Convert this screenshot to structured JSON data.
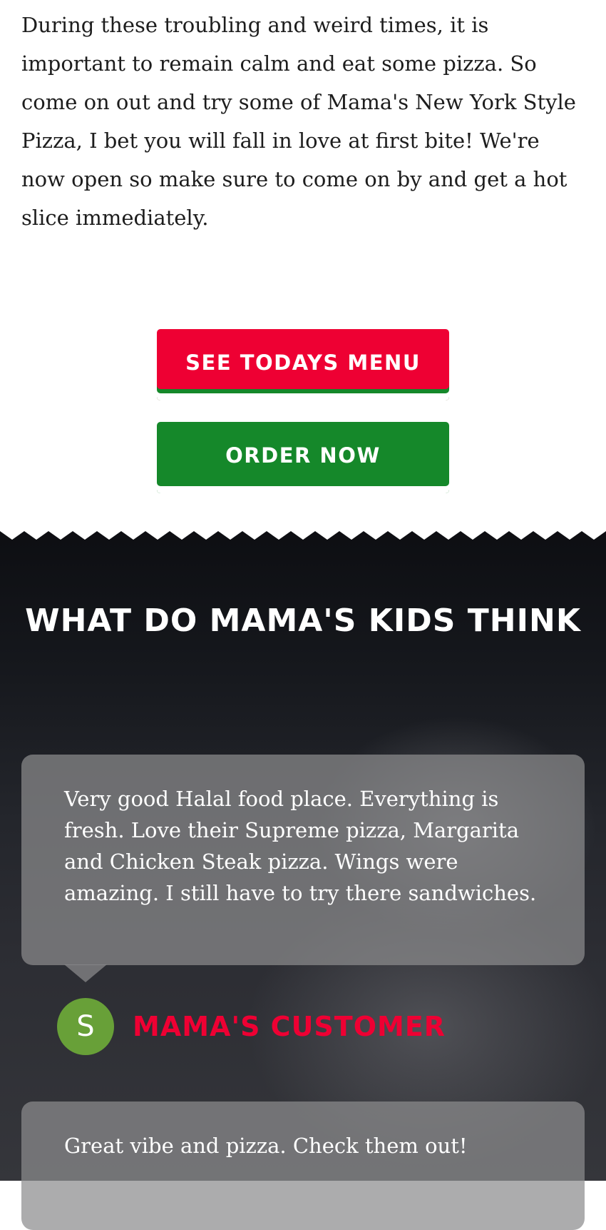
{
  "intro": {
    "text": "During these troubling and weird times, it is important to remain calm and eat some pizza. So come on out and try some of Mama's New York Style Pizza, I bet you will fall in love at first bite! We're now open so make sure to come on by and get a hot slice immediately."
  },
  "buttons": {
    "menu_label": "SEE TODAYS MENU",
    "order_label": "ORDER NOW"
  },
  "testimonials": {
    "title": "WHAT DO MAMA'S KIDS THINK",
    "items": [
      {
        "text": "Very good Halal food place. Everything is fresh. Love their Supreme pizza, Margarita and Chicken Steak pizza. Wings were amazing. I still have to try there sandwiches.",
        "avatar_letter": "S",
        "author": "MAMA'S CUSTOMER"
      },
      {
        "text": "Great vibe and pizza. Check them out!"
      }
    ]
  },
  "colors": {
    "brand_red": "#ee0033",
    "brand_green": "#15882a",
    "avatar_green": "#68a038"
  }
}
